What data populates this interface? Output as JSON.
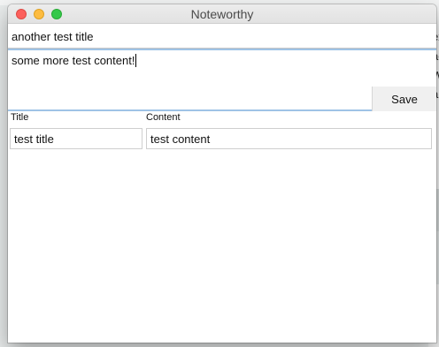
{
  "window": {
    "title": "Noteworthy"
  },
  "editor": {
    "title_value": "another test title",
    "content_value": "some more test content!",
    "save_label": "Save"
  },
  "table": {
    "columns": [
      "Title",
      "Content"
    ],
    "rows": [
      {
        "title": "test title",
        "content": "test content"
      }
    ]
  },
  "background": {
    "partial_chars": [
      "ex",
      "ag",
      "W",
      "a",
      "i"
    ]
  },
  "colors": {
    "focus_ring": "#9fc3e6",
    "close": "#fc605c",
    "minimize": "#fdbc40",
    "maximize": "#34c84a"
  }
}
